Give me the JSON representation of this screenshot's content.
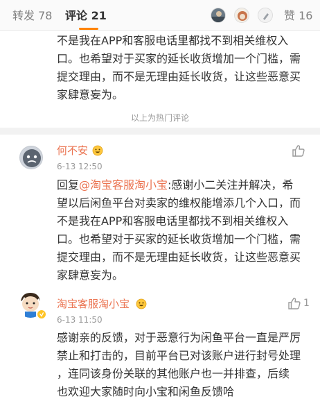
{
  "tabs": {
    "repost": "转发 78",
    "comment": "评论 21",
    "like": "赞 16"
  },
  "top_comment": {
    "lines": [
      "不是我在APP和客服电话里都找不到相关维权入",
      "口。也希望对于买家的延长收货增加一个门槛，需",
      "提交理由，而不是无理由延长收货，让这些恶意买",
      "家肆意妄为。"
    ]
  },
  "hot_divider": "以上为热门评论",
  "comment1": {
    "username": "何不安",
    "time": "6-13 12:50",
    "reply_prefix": "回复",
    "mention": "@淘宝客服淘小宝",
    "lines": [
      ":感谢小二关注并解决，希",
      "望以后闲鱼平台对卖家的维权能增添几个入口，而",
      "不是我在APP和客服电话里都找不到相关维权入",
      "口。也希望对于买家的延长收货增加一个门槛，需",
      "提交理由，而不是无理由延长收货，让这些恶意买",
      "家肆意妄为。"
    ]
  },
  "comment2": {
    "username": "淘宝客服淘小宝",
    "time": "6-13 11:50",
    "like_count": "1",
    "lines": [
      "感谢亲的反馈，对于恶意行为闲鱼平台一直是严厉",
      "禁止和打击的，目前平台已对该账户进行封号处理",
      "，连同该身份关联的其他账户也一并排查，后续",
      "也欢迎大家随时向小宝和闲鱼反馈哈"
    ]
  },
  "colors": {
    "accent": "#ff8200",
    "username": "#eb7350",
    "text": "#333333",
    "meta": "#9a9a9a"
  },
  "icons": {
    "like": "thumbs-up-icon",
    "emoji": "grinning-face-icon",
    "verified": "verified-badge-icon"
  }
}
